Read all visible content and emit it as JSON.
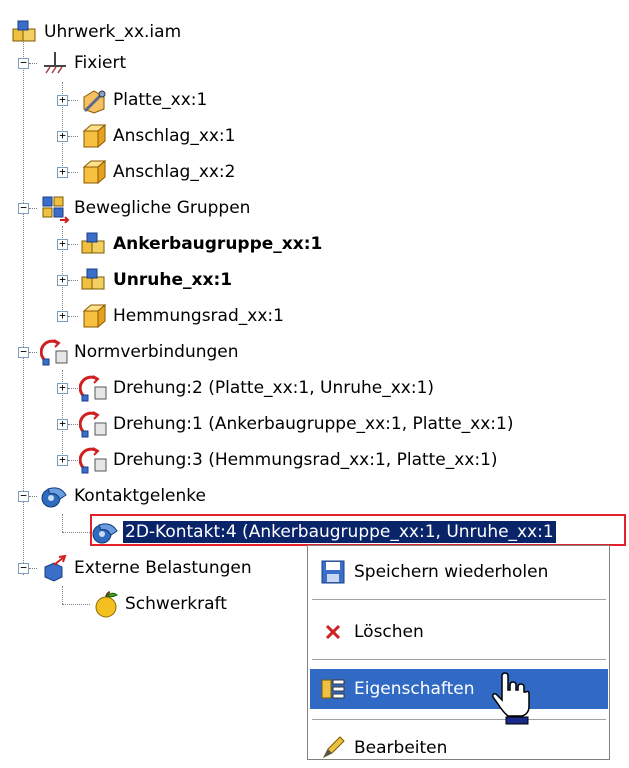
{
  "tree": {
    "root": {
      "label": "Uhrwerk_xx.iam",
      "icon": "assembly-icon"
    },
    "groups": [
      {
        "key": "fixiert",
        "label": "Fixiert",
        "icon": "ground-icon",
        "items": [
          {
            "label": "Platte_xx:1",
            "icon": "pinned-part-icon",
            "bold": false
          },
          {
            "label": "Anschlag_xx:1",
            "icon": "part-icon",
            "bold": false
          },
          {
            "label": "Anschlag_xx:2",
            "icon": "part-icon",
            "bold": false
          }
        ]
      },
      {
        "key": "bewegliche",
        "label": "Bewegliche Gruppen",
        "icon": "mobile-groups-icon",
        "items": [
          {
            "label": "Ankerbaugruppe_xx:1",
            "icon": "assembly-icon",
            "bold": true
          },
          {
            "label": "Unruhe_xx:1",
            "icon": "assembly-icon",
            "bold": true
          },
          {
            "label": "Hemmungsrad_xx:1",
            "icon": "part-icon",
            "bold": false
          }
        ]
      },
      {
        "key": "normverbindungen",
        "label": "Normverbindungen",
        "icon": "joint-icon",
        "items": [
          {
            "label": "Drehung:2 (Platte_xx:1, Unruhe_xx:1)",
            "icon": "rotation-joint-icon",
            "bold": false
          },
          {
            "label": "Drehung:1 (Ankerbaugruppe_xx:1, Platte_xx:1)",
            "icon": "rotation-joint-icon",
            "bold": false
          },
          {
            "label": "Drehung:3 (Hemmungsrad_xx:1, Platte_xx:1)",
            "icon": "rotation-joint-icon",
            "bold": false
          }
        ]
      },
      {
        "key": "kontakt",
        "label": "Kontaktgelenke",
        "icon": "contact-joint-icon",
        "items": [
          {
            "label": "2D-Kontakt:4 (Ankerbaugruppe_xx:1, Unruhe_xx:1",
            "icon": "contact-joint-icon",
            "bold": false,
            "selected": true
          }
        ]
      },
      {
        "key": "belastungen",
        "label": "Externe Belastungen",
        "icon": "external-load-icon",
        "items": [
          {
            "label": "Schwerkraft",
            "icon": "gravity-apple-icon",
            "bold": false
          }
        ]
      }
    ]
  },
  "context_menu": {
    "items": [
      {
        "label": "Speichern wiederholen",
        "icon": "save-icon",
        "highlighted": false
      },
      {
        "label": "Löschen",
        "icon": "delete-x-icon",
        "highlighted": false
      },
      {
        "label": "Eigenschaften",
        "icon": "properties-icon",
        "highlighted": true
      },
      {
        "label": "Bearbeiten",
        "icon": "pencil-icon",
        "highlighted": false
      }
    ]
  },
  "colors": {
    "selection_bg": "#0a246a",
    "selection_border": "#e4202b",
    "menu_highlight": "#316ac5"
  }
}
